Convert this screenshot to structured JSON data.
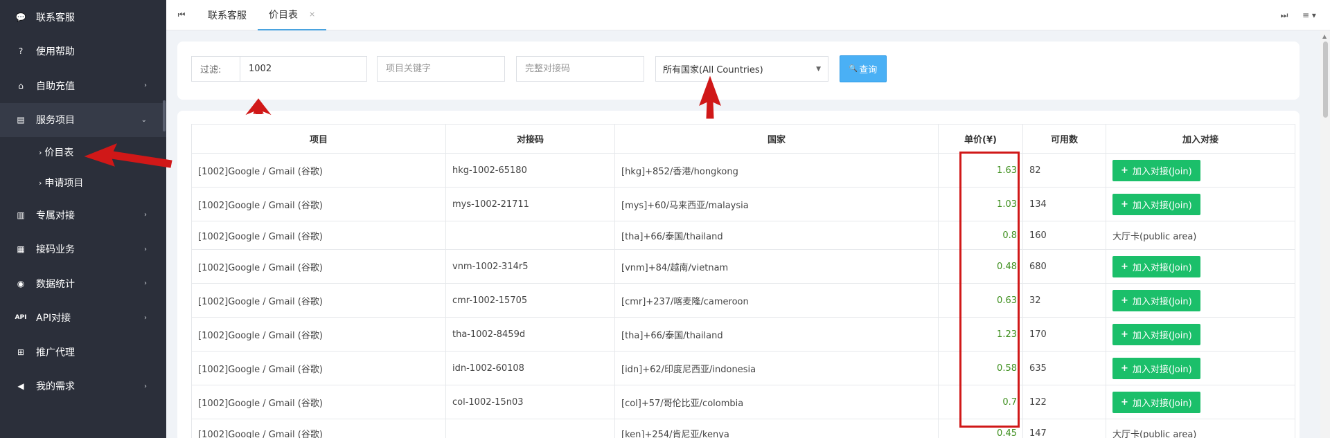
{
  "sidebar": {
    "items": [
      {
        "label": "联系客服",
        "icon": "chat-icon",
        "glyph": "💬",
        "chevron": false
      },
      {
        "label": "使用帮助",
        "icon": "help-icon",
        "glyph": "?",
        "chevron": false
      },
      {
        "label": "自助充值",
        "icon": "bank-icon",
        "glyph": "⌂",
        "chevron": true
      },
      {
        "label": "服务项目",
        "icon": "id-card-icon",
        "glyph": "▤",
        "chevron": true,
        "open": true
      },
      {
        "label": "专属对接",
        "icon": "book-icon",
        "glyph": "▥",
        "chevron": true
      },
      {
        "label": "接码业务",
        "icon": "grid-icon",
        "glyph": "▦",
        "chevron": true
      },
      {
        "label": "数据统计",
        "icon": "database-icon",
        "glyph": "◉",
        "chevron": true
      },
      {
        "label": "API对接",
        "icon": "api-icon",
        "glyph": "API",
        "chevron": true
      },
      {
        "label": "推广代理",
        "icon": "sitemap-icon",
        "glyph": "⊞",
        "chevron": false
      },
      {
        "label": "我的需求",
        "icon": "bullhorn-icon",
        "glyph": "◀",
        "chevron": true
      }
    ],
    "subitems": [
      {
        "label": "价目表"
      },
      {
        "label": "申请项目"
      }
    ]
  },
  "tabs": [
    {
      "label": "联系客服"
    },
    {
      "label": "价目表",
      "closable": true
    }
  ],
  "filter": {
    "label": "过滤:",
    "value": "1002",
    "keyword_placeholder": "项目关键字",
    "code_placeholder": "完整对接码",
    "country_selected": "所有国家(All Countries)",
    "query_label": "查询"
  },
  "table": {
    "headers": [
      "项目",
      "对接码",
      "国家",
      "单价(¥)",
      "可用数",
      "加入对接"
    ],
    "join_label": "加入对接(Join)",
    "rows": [
      {
        "item": "[1002]Google / Gmail (谷歌)",
        "code": "hkg-1002-65180",
        "country": "[hkg]+852/香港/hongkong",
        "price": "1.63",
        "count": "82",
        "action": "join"
      },
      {
        "item": "[1002]Google / Gmail (谷歌)",
        "code": "mys-1002-21711",
        "country": "[mys]+60/马来西亚/malaysia",
        "price": "1.03",
        "count": "134",
        "action": "join"
      },
      {
        "item": "[1002]Google / Gmail (谷歌)",
        "code": "",
        "country": "[tha]+66/泰国/thailand",
        "price": "0.8",
        "count": "160",
        "action": "大厅卡(public area)"
      },
      {
        "item": "[1002]Google / Gmail (谷歌)",
        "code": "vnm-1002-314r5",
        "country": "[vnm]+84/越南/vietnam",
        "price": "0.48",
        "count": "680",
        "action": "join"
      },
      {
        "item": "[1002]Google / Gmail (谷歌)",
        "code": "cmr-1002-15705",
        "country": "[cmr]+237/喀麦隆/cameroon",
        "price": "0.63",
        "count": "32",
        "action": "join"
      },
      {
        "item": "[1002]Google / Gmail (谷歌)",
        "code": "tha-1002-8459d",
        "country": "[tha]+66/泰国/thailand",
        "price": "1.23",
        "count": "170",
        "action": "join"
      },
      {
        "item": "[1002]Google / Gmail (谷歌)",
        "code": "idn-1002-60108",
        "country": "[idn]+62/印度尼西亚/indonesia",
        "price": "0.58",
        "count": "635",
        "action": "join"
      },
      {
        "item": "[1002]Google / Gmail (谷歌)",
        "code": "col-1002-15n03",
        "country": "[col]+57/哥伦比亚/colombia",
        "price": "0.7",
        "count": "122",
        "action": "join"
      },
      {
        "item": "[1002]Google / Gmail (谷歌)",
        "code": "",
        "country": "[ken]+254/肯尼亚/kenya",
        "price": "0.45",
        "count": "147",
        "action": "大厅卡(public area)"
      }
    ]
  },
  "colors": {
    "sidebar_bg": "#2b2f3a",
    "query_button": "#4ab0f5",
    "join_button": "#1bbf6a",
    "price_text": "#3e8f1e",
    "annotation_red": "#d01818"
  }
}
